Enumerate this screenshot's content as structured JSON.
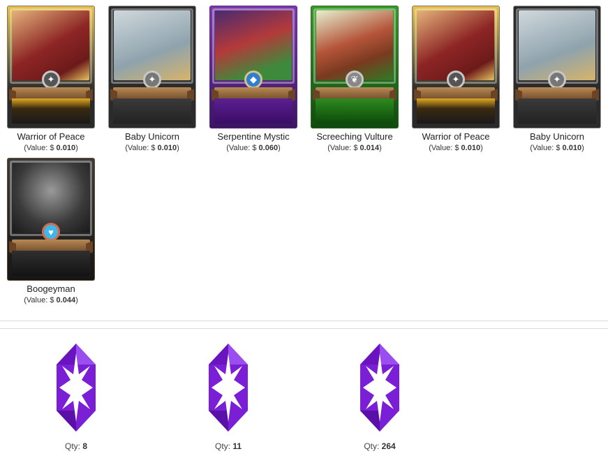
{
  "cards": [
    {
      "name": "Warrior of Peace",
      "value_prefix": "(Value: $ ",
      "value": "0.010",
      "value_suffix": ")",
      "theme": "warrior",
      "gem_icon": "sparkle-icon"
    },
    {
      "name": "Baby Unicorn",
      "value_prefix": "(Value: $ ",
      "value": "0.010",
      "value_suffix": ")",
      "theme": "neutral",
      "gem_icon": "sparkle-icon"
    },
    {
      "name": "Serpentine Mystic",
      "value_prefix": "(Value: $ ",
      "value": "0.060",
      "value_suffix": ")",
      "theme": "death",
      "gem_icon": "gem-icon"
    },
    {
      "name": "Screeching Vulture",
      "value_prefix": "(Value: $ ",
      "value": "0.014",
      "value_suffix": ")",
      "theme": "earth",
      "gem_icon": "leaf-icon"
    },
    {
      "name": "Warrior of Peace",
      "value_prefix": "(Value: $ ",
      "value": "0.010",
      "value_suffix": ")",
      "theme": "warrior",
      "gem_icon": "sparkle-icon"
    },
    {
      "name": "Baby Unicorn",
      "value_prefix": "(Value: $ ",
      "value": "0.010",
      "value_suffix": ")",
      "theme": "neutral",
      "gem_icon": "sparkle-icon"
    },
    {
      "name": "Boogeyman",
      "value_prefix": "(Value: $ ",
      "value": "0.044",
      "value_suffix": ")",
      "theme": "boogey",
      "gem_icon": "heart-gem-icon"
    }
  ],
  "potions": [
    {
      "qty_label": "Qty: ",
      "qty": "8",
      "icon": "legendary-potion-icon",
      "color": "#7b1fd6"
    },
    {
      "qty_label": "Qty: ",
      "qty": "11",
      "icon": "legendary-potion-icon",
      "color": "#7b1fd6"
    },
    {
      "qty_label": "Qty: ",
      "qty": "264",
      "icon": "legendary-potion-icon",
      "color": "#7b1fd6"
    }
  ]
}
